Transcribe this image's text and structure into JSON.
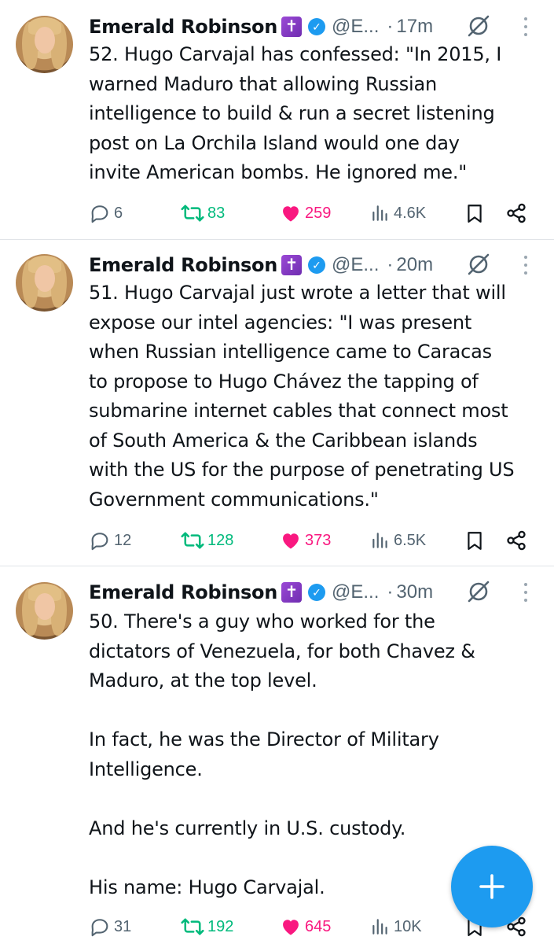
{
  "colors": {
    "accent": "#1d9bf0",
    "retweet": "#00ba7c",
    "like": "#f91880",
    "muted": "#536471",
    "badge": "#7d35c0"
  },
  "icons": {
    "reply": "reply-icon",
    "retweet": "retweet-icon",
    "like": "heart-icon",
    "views": "views-icon",
    "bookmark": "bookmark-icon",
    "share": "share-icon",
    "grok": "grok-icon",
    "more": "more-icon",
    "compose": "plus-icon"
  },
  "tweets": [
    {
      "name": "Emerald Robinson",
      "badge": "✝",
      "handle": "@E...",
      "dot": "·",
      "time": "17m",
      "text": "52. Hugo Carvajal has confessed: \"In 2015, I\nwarned Maduro that allowing Russian\nintelligence to build & run a secret listening\npost on La Orchila Island would one day\ninvite American bombs. He ignored me.\"",
      "replies": "6",
      "retweets": "83",
      "likes": "259",
      "views": "4.6K"
    },
    {
      "name": "Emerald Robinson",
      "badge": "✝",
      "handle": "@E...",
      "dot": "·",
      "time": "20m",
      "text": "51. Hugo Carvajal just wrote a letter that will\nexpose our intel agencies: \"I was present\nwhen Russian intelligence came to Caracas\nto propose to Hugo Chávez the tapping of\nsubmarine internet cables that connect most\nof South America & the Caribbean islands\nwith the US for the purpose of penetrating US\nGovernment communications.\"",
      "replies": "12",
      "retweets": "128",
      "likes": "373",
      "views": "6.5K"
    },
    {
      "name": "Emerald Robinson",
      "badge": "✝",
      "handle": "@E...",
      "dot": "·",
      "time": "30m",
      "text": "50. There's a guy who worked for the\ndictators of Venezuela, for both Chavez &\nMaduro, at the top level.\n\nIn fact, he was the Director of Military\nIntelligence.\n\nAnd he's currently in U.S. custody.\n\nHis name:  Hugo Carvajal.",
      "replies": "31",
      "retweets": "192",
      "likes": "645",
      "views": "10K"
    }
  ]
}
